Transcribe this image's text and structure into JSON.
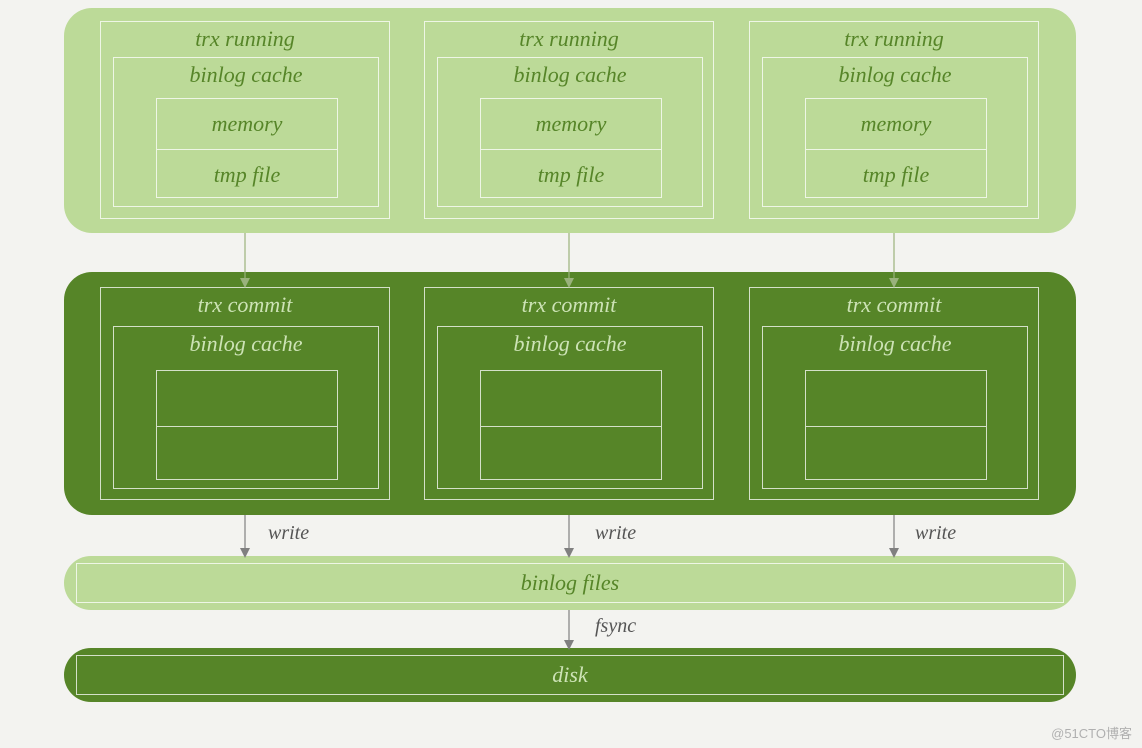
{
  "labels": {
    "trx_running": "trx running",
    "binlog_cache": "binlog cache",
    "memory": "memory",
    "tmp_file": "tmp file",
    "trx_commit": "trx commit",
    "binlog_files": "binlog files",
    "disk": "disk",
    "write": "write",
    "fsync": "fsync"
  },
  "watermark": "@51CTO博客",
  "colors": {
    "light_bg": "#bcda98",
    "dark_bg": "#568528",
    "page_bg": "#f3f3f0",
    "text_dark": "#568528",
    "text_light": "#cde3b6"
  },
  "diagram": {
    "columns": 3,
    "flow": [
      "trx running → (arrow) → trx commit",
      "trx commit → write → binlog files",
      "binlog files → fsync → disk"
    ],
    "trx_running_contents": [
      "binlog cache",
      "memory",
      "tmp file"
    ],
    "trx_commit_contents": [
      "binlog cache",
      "(empty)",
      "(empty)"
    ]
  }
}
